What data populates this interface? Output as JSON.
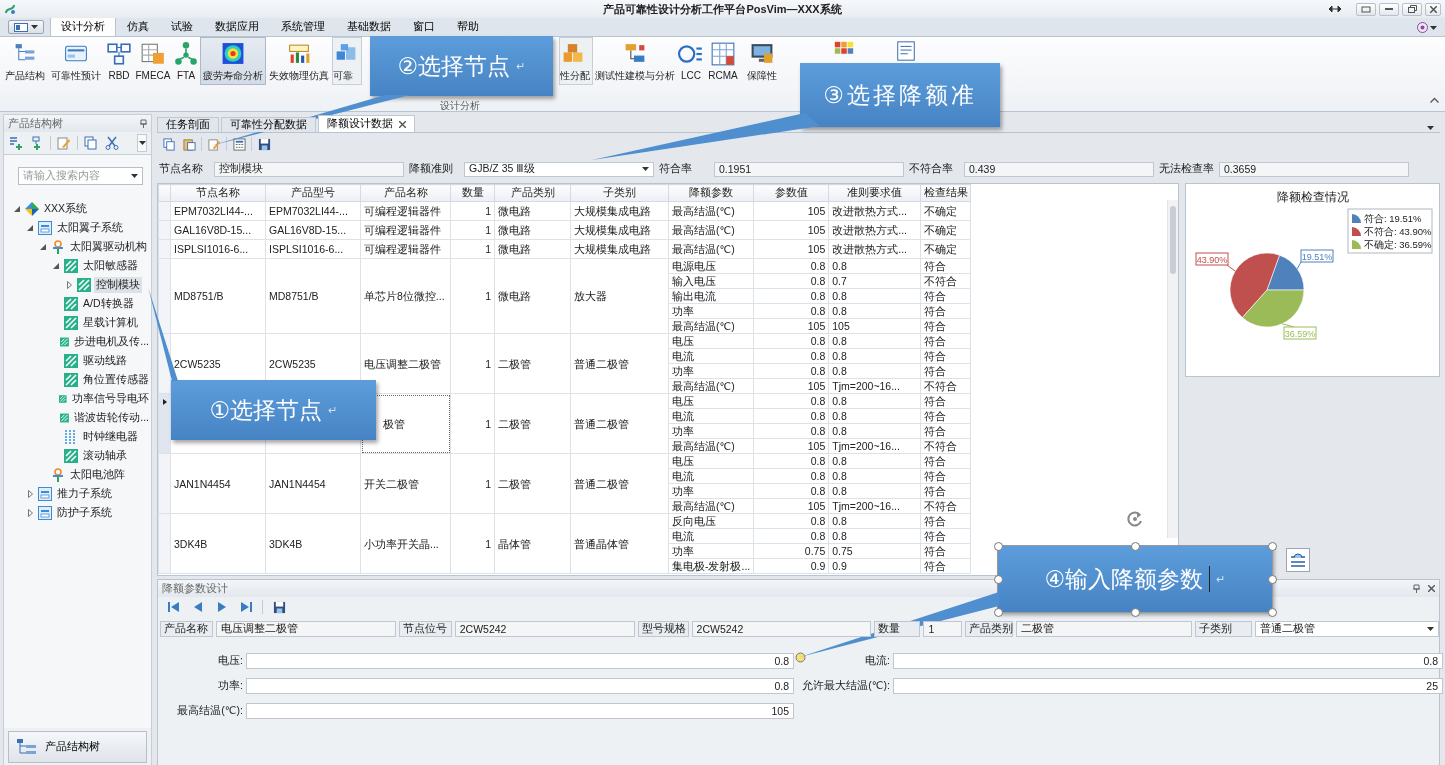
{
  "window": {
    "title": "产品可靠性设计分析工作平台PosVim—XXX系统"
  },
  "menu_tabs": [
    {
      "label": "设计分析",
      "selected": true
    },
    {
      "label": "仿真",
      "selected": false
    },
    {
      "label": "试验",
      "selected": false
    },
    {
      "label": "数据应用",
      "selected": false
    },
    {
      "label": "系统管理",
      "selected": false
    },
    {
      "label": "基础数据",
      "selected": false
    },
    {
      "label": "窗口",
      "selected": false
    },
    {
      "label": "帮助",
      "selected": false
    }
  ],
  "ribbon": {
    "group_label": "设计分析",
    "items": [
      {
        "label": "产品结构",
        "selected": false
      },
      {
        "label": "可靠性预计",
        "selected": false
      },
      {
        "label": "RBD",
        "selected": false
      },
      {
        "label": "FMECA",
        "selected": false
      },
      {
        "label": "FTA",
        "selected": false
      },
      {
        "label": "疲劳寿命分析",
        "selected": true
      },
      {
        "label": "失效物理仿真",
        "selected": false
      },
      {
        "label": "可靠",
        "selected": false
      },
      {
        "label": "性分配",
        "selected": false
      },
      {
        "label": "测试性建模与分析",
        "selected": false
      },
      {
        "label": "LCC",
        "selected": false
      },
      {
        "label": "RCMA",
        "selected": false
      },
      {
        "label": "保障性",
        "selected": false
      }
    ]
  },
  "tree_pane": {
    "title": "产品结构树",
    "search": {
      "placeholder": "请输入搜索内容"
    },
    "bottom_button": "产品结构树",
    "tree": [
      {
        "label": "XXX系统",
        "kind": "system",
        "expanded": true,
        "selected": false,
        "children": [
          {
            "label": "太阳翼子系统",
            "kind": "subsystem",
            "expanded": true,
            "selected": false,
            "children": [
              {
                "label": "太阳翼驱动机构",
                "kind": "assembly",
                "expanded": true,
                "selected": false,
                "children": [
                  {
                    "label": "太阳敏感器",
                    "kind": "part",
                    "expanded": true,
                    "selected": false,
                    "children": [
                      {
                        "label": "控制模块",
                        "kind": "part",
                        "expanded": false,
                        "selected": true
                      }
                    ]
                  },
                  {
                    "label": "A/D转换器",
                    "kind": "part",
                    "selected": false
                  },
                  {
                    "label": "星载计算机",
                    "kind": "part",
                    "selected": false
                  },
                  {
                    "label": "步进电机及传...",
                    "kind": "part",
                    "selected": false
                  },
                  {
                    "label": "驱动线路",
                    "kind": "part",
                    "selected": false
                  },
                  {
                    "label": "角位置传感器",
                    "kind": "part",
                    "selected": false
                  },
                  {
                    "label": "功率信号导电环",
                    "kind": "part",
                    "selected": false
                  },
                  {
                    "label": "谐波齿轮传动...",
                    "kind": "part",
                    "selected": false
                  },
                  {
                    "label": "时钟继电器",
                    "kind": "relay",
                    "selected": false
                  },
                  {
                    "label": "滚动轴承",
                    "kind": "part",
                    "selected": false
                  }
                ]
              },
              {
                "label": "太阳电池阵",
                "kind": "assembly",
                "selected": false
              }
            ]
          },
          {
            "label": "推力子系统",
            "kind": "subsystem",
            "expanded": false,
            "selected": false
          },
          {
            "label": "防护子系统",
            "kind": "subsystem",
            "expanded": false,
            "selected": false
          }
        ]
      }
    ]
  },
  "doc_tabs": [
    {
      "label": "任务剖面",
      "selected": false
    },
    {
      "label": "可靠性分配数据",
      "selected": false
    },
    {
      "label": "降额设计数据",
      "selected": true,
      "closable": true
    }
  ],
  "filter": [
    {
      "label": "节点名称",
      "value": "控制模块",
      "kind": "text"
    },
    {
      "label": "降额准则",
      "value": "GJB/Z 35 Ⅲ级",
      "kind": "dropdown"
    },
    {
      "label": "符合率",
      "value": "0.1951",
      "kind": "text"
    },
    {
      "label": "不符合率",
      "value": "0.439",
      "kind": "text"
    },
    {
      "label": "无法检查率",
      "value": "0.3659",
      "kind": "text"
    }
  ],
  "table": {
    "columns": [
      "节点名称",
      "产品型号",
      "产品名称",
      "数量",
      "产品类别",
      "子类别",
      "降额参数",
      "参数值",
      "准则要求值",
      "检查结果"
    ],
    "groups": [
      {
        "node_name": "EPM7032LI44-...",
        "model": "EPM7032LI44-...",
        "product_name": "可编程逻辑器件",
        "quantity": "1",
        "category": "微电路",
        "subcategory": "大规模集成电路",
        "selected": false,
        "params": [
          {
            "name": "最高结温(℃)",
            "value": "105",
            "requirement": "改进散热方式...",
            "result": "不确定"
          }
        ]
      },
      {
        "node_name": "GAL16V8D-15...",
        "model": "GAL16V8D-15...",
        "product_name": "可编程逻辑器件",
        "quantity": "1",
        "category": "微电路",
        "subcategory": "大规模集成电路",
        "selected": false,
        "params": [
          {
            "name": "最高结温(℃)",
            "value": "105",
            "requirement": "改进散热方式...",
            "result": "不确定"
          }
        ]
      },
      {
        "node_name": "ISPLSI1016-6...",
        "model": "ISPLSI1016-6...",
        "product_name": "可编程逻辑器件",
        "quantity": "1",
        "category": "微电路",
        "subcategory": "大规模集成电路",
        "selected": false,
        "params": [
          {
            "name": "最高结温(℃)",
            "value": "105",
            "requirement": "改进散热方式...",
            "result": "不确定"
          }
        ]
      },
      {
        "node_name": "MD8751/B",
        "model": "MD8751/B",
        "product_name": "单芯片8位微控...",
        "quantity": "1",
        "category": "微电路",
        "subcategory": "放大器",
        "selected": false,
        "params": [
          {
            "name": "电源电压",
            "value": "0.8",
            "requirement": "0.8",
            "result": "符合"
          },
          {
            "name": "输入电压",
            "value": "0.8",
            "requirement": "0.7",
            "result": "不符合"
          },
          {
            "name": "输出电流",
            "value": "0.8",
            "requirement": "0.8",
            "result": "符合"
          },
          {
            "name": "功率",
            "value": "0.8",
            "requirement": "0.8",
            "result": "符合"
          },
          {
            "name": "最高结温(℃)",
            "value": "105",
            "requirement": "105",
            "result": "符合"
          }
        ]
      },
      {
        "node_name": "2CW5235",
        "model": "2CW5235",
        "product_name": "电压调整二极管",
        "quantity": "1",
        "category": "二极管",
        "subcategory": "普通二极管",
        "selected": false,
        "params": [
          {
            "name": "电压",
            "value": "0.8",
            "requirement": "0.8",
            "result": "符合"
          },
          {
            "name": "电流",
            "value": "0.8",
            "requirement": "0.8",
            "result": "符合"
          },
          {
            "name": "功率",
            "value": "0.8",
            "requirement": "0.8",
            "result": "符合"
          },
          {
            "name": "最高结温(℃)",
            "value": "105",
            "requirement": "Tjm=200~16...",
            "result": "不符合"
          }
        ]
      },
      {
        "product_name": "极管",
        "quantity": "1",
        "category": "二极管",
        "subcategory": "普通二极管",
        "selected": true,
        "params": [
          {
            "name": "电压",
            "value": "0.8",
            "requirement": "0.8",
            "result": "符合"
          },
          {
            "name": "电流",
            "value": "0.8",
            "requirement": "0.8",
            "result": "符合"
          },
          {
            "name": "功率",
            "value": "0.8",
            "requirement": "0.8",
            "result": "符合"
          },
          {
            "name": "最高结温(℃)",
            "value": "105",
            "requirement": "Tjm=200~16...",
            "result": "不符合"
          }
        ]
      },
      {
        "node_name": "JAN1N4454",
        "model": "JAN1N4454",
        "product_name": "开关二极管",
        "quantity": "1",
        "category": "二极管",
        "subcategory": "普通二极管",
        "selected": false,
        "params": [
          {
            "name": "电压",
            "value": "0.8",
            "requirement": "0.8",
            "result": "符合"
          },
          {
            "name": "电流",
            "value": "0.8",
            "requirement": "0.8",
            "result": "符合"
          },
          {
            "name": "功率",
            "value": "0.8",
            "requirement": "0.8",
            "result": "符合"
          },
          {
            "name": "最高结温(℃)",
            "value": "105",
            "requirement": "Tjm=200~16...",
            "result": "不符合"
          }
        ]
      },
      {
        "node_name": "3DK4B",
        "model": "3DK4B",
        "product_name": "小功率开关晶...",
        "quantity": "1",
        "category": "晶体管",
        "subcategory": "普通晶体管",
        "selected": false,
        "params": [
          {
            "name": "反向电压",
            "value": "0.8",
            "requirement": "0.8",
            "result": "符合"
          },
          {
            "name": "电流",
            "value": "0.8",
            "requirement": "0.8",
            "result": "符合"
          },
          {
            "name": "功率",
            "value": "0.75",
            "requirement": "0.75",
            "result": "符合"
          },
          {
            "name": "集电极-发射极...",
            "value": "0.9",
            "requirement": "0.9",
            "result": "符合"
          }
        ]
      }
    ]
  },
  "chart_panel": {
    "legend": [
      {
        "label": "符合: 19.51%",
        "color": "#4f81bd"
      },
      {
        "label": "不符合: 43.90%",
        "color": "#c0504d"
      },
      {
        "label": "不确定: 36.59%",
        "color": "#9bbb59"
      }
    ],
    "chart_data": {
      "type": "pie",
      "title": "降额检查情况",
      "series": [
        {
          "values": [
            19.51,
            43.9,
            36.59
          ]
        }
      ],
      "value_labels": [
        "19.51%",
        "43.90%",
        "36.59%"
      ]
    }
  },
  "param_panel": {
    "title": "降额参数设计",
    "info": [
      {
        "label": "产品名称",
        "value": "电压调整二极管",
        "kind": "text"
      },
      {
        "label": "节点位号",
        "value": "2CW5242",
        "kind": "text"
      },
      {
        "label": "型号规格",
        "value": "2CW5242",
        "kind": "text"
      },
      {
        "label": "数量",
        "value": "1",
        "kind": "text"
      },
      {
        "label": "产品类别",
        "value": "二极管",
        "kind": "text"
      },
      {
        "label": "子类别",
        "value": "普通二极管",
        "kind": "dropdown"
      }
    ],
    "fields": [
      {
        "label": "电压:",
        "value": "0.8"
      },
      {
        "label": "电流:",
        "value": "0.8"
      },
      {
        "label": "功率:",
        "value": "0.8"
      },
      {
        "label": "允许最大结温(℃):",
        "value": "25"
      },
      {
        "label": "最高结温(℃):",
        "value": "105"
      }
    ]
  },
  "callouts": [
    {
      "text": "②选择节点",
      "mark": "↵",
      "selected": false
    },
    {
      "text": "③选择降额准",
      "selected": false
    },
    {
      "text": "①选择节点",
      "mark": "↵",
      "selected": false
    },
    {
      "text": "④输入降额参数",
      "mark": "↵",
      "selected": true
    }
  ]
}
